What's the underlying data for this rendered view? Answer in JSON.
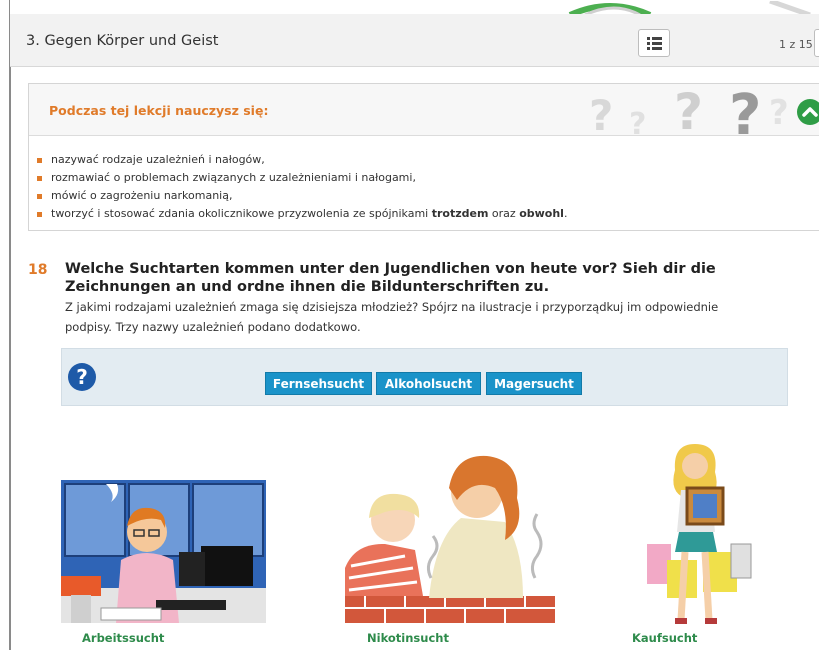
{
  "header": {
    "chapter_title": "3. Gegen Körper und Geist",
    "page_counter": "1 z 15",
    "toc_icon": "list-icon"
  },
  "goals": {
    "title": "Podczas tej lekcji nauczysz się:",
    "items": [
      "nazywać rodzaje uzależnień i nałogów,",
      "rozmawiać o problemach związanych z uzależnieniami i nałogami,",
      "mówić o zagrożeniu narkomanią,"
    ],
    "last_item_prefix": "tworzyć i stosować zdania okolicznikowe przyzwolenia ze spójnikami ",
    "last_item_bold1": "trotzdem",
    "last_item_mid": " oraz ",
    "last_item_bold2": "obwohl",
    "last_item_end": "."
  },
  "exercise": {
    "number": "18",
    "title": "Welche Suchtarten kommen unter den Jugendlichen von heute vor? Sieh dir die Zeichnungen an und ordne ihnen die Bildunterschriften zu.",
    "subtitle": "Z jakimi rodzajami uzależnień zmaga się dzisiejsza młodzież? Spójrz na ilustracje i przyporządkuj im odpowiednie podpisy. Trzy nazwy uzależnień podano dodatkowo.",
    "help_label": "?",
    "tiles": [
      "Fernsehsucht",
      "Alkoholsucht",
      "Magersucht"
    ],
    "captions": [
      "Arbeitssucht",
      "Nikotinsucht",
      "Kaufsucht"
    ]
  },
  "colors": {
    "accent_orange": "#e07b2a",
    "tile_blue": "#1a93c9",
    "caption_green": "#2e8b4b",
    "help_blue": "#1e5aa8"
  }
}
